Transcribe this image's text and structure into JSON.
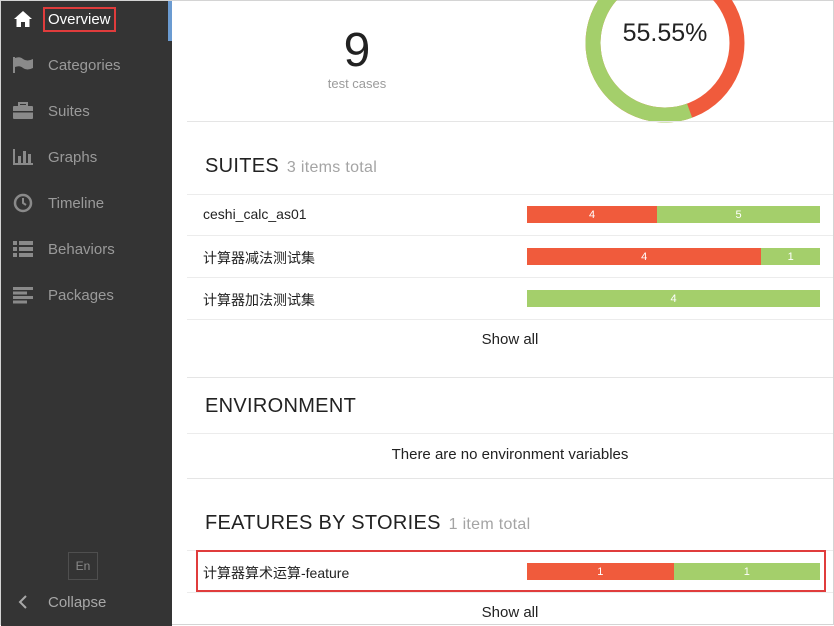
{
  "sidebar": {
    "items": [
      {
        "label": "Overview",
        "icon": "home-icon",
        "active": true
      },
      {
        "label": "Categories",
        "icon": "flag-icon"
      },
      {
        "label": "Suites",
        "icon": "briefcase-icon"
      },
      {
        "label": "Graphs",
        "icon": "bar-chart-icon"
      },
      {
        "label": "Timeline",
        "icon": "clock-icon"
      },
      {
        "label": "Behaviors",
        "icon": "list-icon"
      },
      {
        "label": "Packages",
        "icon": "align-left-icon"
      }
    ],
    "language": "En",
    "collapse_label": "Collapse"
  },
  "summary": {
    "test_count": "9",
    "test_count_label": "test cases",
    "success_rate": "55.55%",
    "success_fraction": 0.5555,
    "colors": {
      "passed": "#a4cf6b",
      "failed": "#f05b3c"
    }
  },
  "suites": {
    "title": "SUITES",
    "count_label": "3 items total",
    "rows": [
      {
        "name": "ceshi_calc_as01",
        "failed": "4",
        "passed": "5",
        "failed_n": 4,
        "passed_n": 5
      },
      {
        "name": "计算器减法测试集",
        "failed": "4",
        "passed": "1",
        "failed_n": 4,
        "passed_n": 1
      },
      {
        "name": "计算器加法测试集",
        "failed": "",
        "passed": "4",
        "failed_n": 0,
        "passed_n": 4
      }
    ],
    "show_all": "Show all"
  },
  "environment": {
    "title": "ENVIRONMENT",
    "empty_message": "There are no environment variables"
  },
  "features": {
    "title": "FEATURES BY STORIES",
    "count_label": "1 item total",
    "rows": [
      {
        "name": "计算器算术运算-feature",
        "failed": "1",
        "passed": "1",
        "failed_n": 1,
        "passed_n": 1
      }
    ],
    "show_all": "Show all"
  }
}
